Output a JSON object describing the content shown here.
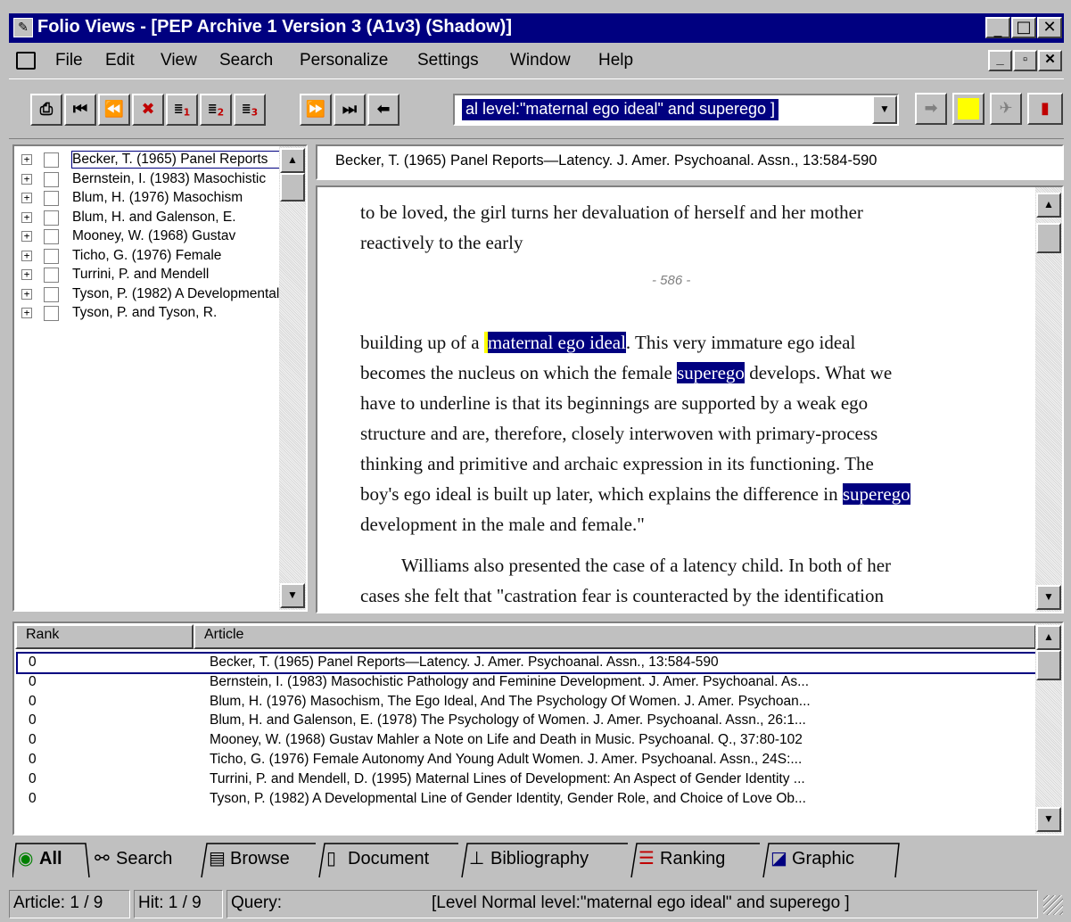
{
  "window": {
    "title": "Folio Views - [PEP Archive 1 Version 3 (A1v3) (Shadow)]"
  },
  "menu": {
    "items": [
      {
        "label": "File"
      },
      {
        "label": "Edit"
      },
      {
        "label": "View"
      },
      {
        "label": "Search"
      },
      {
        "label": "Personalize"
      },
      {
        "label": "Settings"
      },
      {
        "label": "Window"
      },
      {
        "label": "Help"
      }
    ]
  },
  "toolbar": {
    "query_value": "al level:\"maternal ego ideal\" and superego ]"
  },
  "tree": {
    "items": [
      {
        "label": "Becker, T. (1965) Panel Reports"
      },
      {
        "label": "Bernstein, I. (1983) Masochistic"
      },
      {
        "label": "Blum, H. (1976) Masochism"
      },
      {
        "label": "Blum, H. and Galenson, E."
      },
      {
        "label": "Mooney, W. (1968) Gustav"
      },
      {
        "label": "Ticho, G. (1976) Female"
      },
      {
        "label": "Turrini, P. and Mendell"
      },
      {
        "label": "Tyson, P. (1982) A Developmental"
      },
      {
        "label": "Tyson, P. and Tyson, R."
      }
    ]
  },
  "document": {
    "header": "Becker, T. (1965) Panel Reports—Latency.  J. Amer. Psychoanal. Assn., 13:584-590",
    "line1": "to be loved, the girl turns her devaluation of herself and her mother",
    "line2": "reactively to the early",
    "page_marker": "- 586 -",
    "l3a": "building up of a ",
    "l3hl": "maternal ego ideal",
    "l3b": ".  This very immature ego ideal",
    "l4a": "becomes the nucleus on which the female ",
    "l4hl": "superego",
    "l4b": " develops.  What we",
    "l5": "have to underline is that its beginnings are supported by a weak ego",
    "l6": "structure and are, therefore, closely interwoven with primary-process",
    "l7": "thinking and primitive and archaic expression in its functioning.  The",
    "l8a": "boy's ego ideal is built up later, which explains the difference in ",
    "l8hl": "superego",
    "l9": "development in the male and female.\"",
    "l10": "Williams also presented the case of a latency child.  In both of her",
    "l11": "cases she felt that \"castration fear is counteracted by the identification"
  },
  "results": {
    "col_rank": "Rank",
    "col_article": "Article",
    "rows": [
      {
        "rank": "0",
        "article": "Becker, T. (1965) Panel Reports—Latency.  J. Amer. Psychoanal. Assn., 13:584-590"
      },
      {
        "rank": "0",
        "article": "Bernstein, I. (1983) Masochistic Pathology and Feminine Development.  J. Amer. Psychoanal. As..."
      },
      {
        "rank": "0",
        "article": "Blum, H. (1976) Masochism, The Ego Ideal, And The Psychology Of Women.  J. Amer. Psychoan..."
      },
      {
        "rank": "0",
        "article": "Blum, H. and Galenson, E. (1978) The Psychology of Women.  J. Amer. Psychoanal. Assn., 26:1..."
      },
      {
        "rank": "0",
        "article": "Mooney, W. (1968) Gustav Mahler a Note on Life and Death in Music.  Psychoanal. Q., 37:80-102"
      },
      {
        "rank": "0",
        "article": "Ticho, G. (1976) Female Autonomy And Young Adult Women.  J. Amer. Psychoanal. Assn., 24S:..."
      },
      {
        "rank": "0",
        "article": "Turrini, P. and Mendell, D. (1995) Maternal Lines of Development: An Aspect of Gender Identity ..."
      },
      {
        "rank": "0",
        "article": "Tyson, P. (1982) A Developmental Line of Gender Identity, Gender Role, and Choice of Love Ob..."
      }
    ]
  },
  "tabs": [
    {
      "label": "All"
    },
    {
      "label": "Search"
    },
    {
      "label": "Browse"
    },
    {
      "label": "Document"
    },
    {
      "label": "Bibliography"
    },
    {
      "label": "Ranking"
    },
    {
      "label": "Graphic"
    }
  ],
  "status": {
    "article": "Article: 1 / 9",
    "hit": "Hit: 1 / 9",
    "query_label": "Query:",
    "query": "[Level Normal level:\"maternal ego ideal\" and superego ]"
  }
}
